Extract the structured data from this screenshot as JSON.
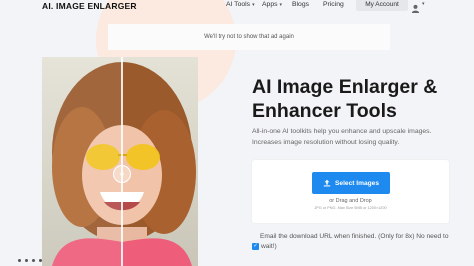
{
  "header": {
    "logo": "AI. IMAGE ENLARGER",
    "nav": [
      {
        "label": "AI Tools",
        "has_caret": true
      },
      {
        "label": "Apps",
        "has_caret": true
      },
      {
        "label": "Blogs",
        "has_caret": false
      },
      {
        "label": "Pricing",
        "has_caret": false
      }
    ],
    "account_label": "My Account",
    "user_icon": "user-icon"
  },
  "ad": {
    "text": "We'll try not to show that ad again"
  },
  "hero": {
    "title": "AI Image Enlarger & Enhancer Tools",
    "description": "All-in-one AI toolkits help you enhance and upscale images. Increases image resolution without losing quality."
  },
  "upload": {
    "button_label": "Select Images",
    "button_icon": "upload-icon",
    "drag_text": "or Drag and Drop",
    "format_text": "JPG or PNG. Max Size 5MB or 1200×1200"
  },
  "email_option": {
    "line1": "Email the download URL when finished. (Only for 8x) No need to",
    "line2": "wait!)",
    "checked": true
  },
  "colors": {
    "accent": "#1e8af0",
    "background": "#f3f4f7",
    "blob": "#fde6dc"
  }
}
